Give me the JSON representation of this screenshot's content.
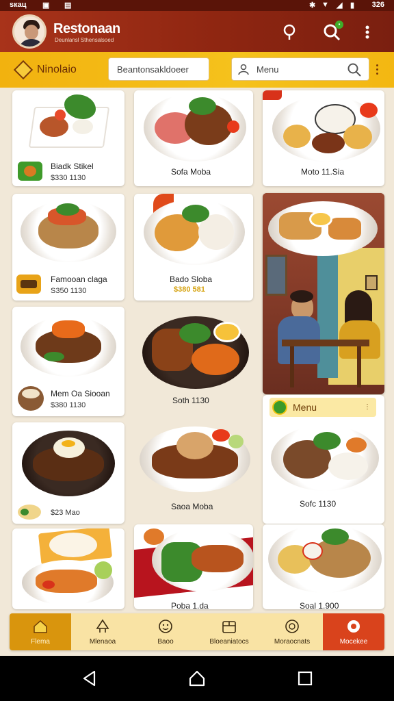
{
  "status_bar": {
    "time": "ѕкац",
    "battery": "326"
  },
  "app_bar": {
    "title": "Restonaan",
    "subtitle": "Deunlansl Sthensalsoed"
  },
  "toolbar": {
    "brand": "Ninolaio",
    "middle_field": "Beantonsakldoeer",
    "search_placeholder": "Menu"
  },
  "dishes": [
    {
      "title": "Biadk Stikel",
      "price": "$330 1130"
    },
    {
      "title": "Sofa Moba",
      "price": ""
    },
    {
      "title": "Moto 11.Sia",
      "price": ""
    },
    {
      "title": "Famooan claga",
      "price": "S350 1130"
    },
    {
      "title": "Bado Sloba",
      "price": "$380 581"
    },
    {
      "title": "Mem Oa Siooan",
      "price": "$380 1130"
    },
    {
      "title": "Soth 1130",
      "price": ""
    },
    {
      "title": "",
      "price": "$23 Mao"
    },
    {
      "title": "Saoa Moba",
      "price": ""
    },
    {
      "title": "Sofc 1130",
      "price": ""
    },
    {
      "title": "Poba 1.da",
      "price": ""
    },
    {
      "title": "Soal 1.900",
      "price": ""
    }
  ],
  "menu_chip": {
    "label": "Menu",
    "more": "⋮"
  },
  "bottom_nav": [
    {
      "label": "Flema"
    },
    {
      "label": "Mlenaoa"
    },
    {
      "label": "Baoo"
    },
    {
      "label": "Bloeaniatocs"
    },
    {
      "label": "Moraocnats"
    },
    {
      "label": "Mocekee"
    }
  ],
  "colors": {
    "app_bar": "#8f2611",
    "toolbar": "#f5c21c",
    "nav_active": "#d9950d",
    "nav_accent": "#d9431c"
  }
}
